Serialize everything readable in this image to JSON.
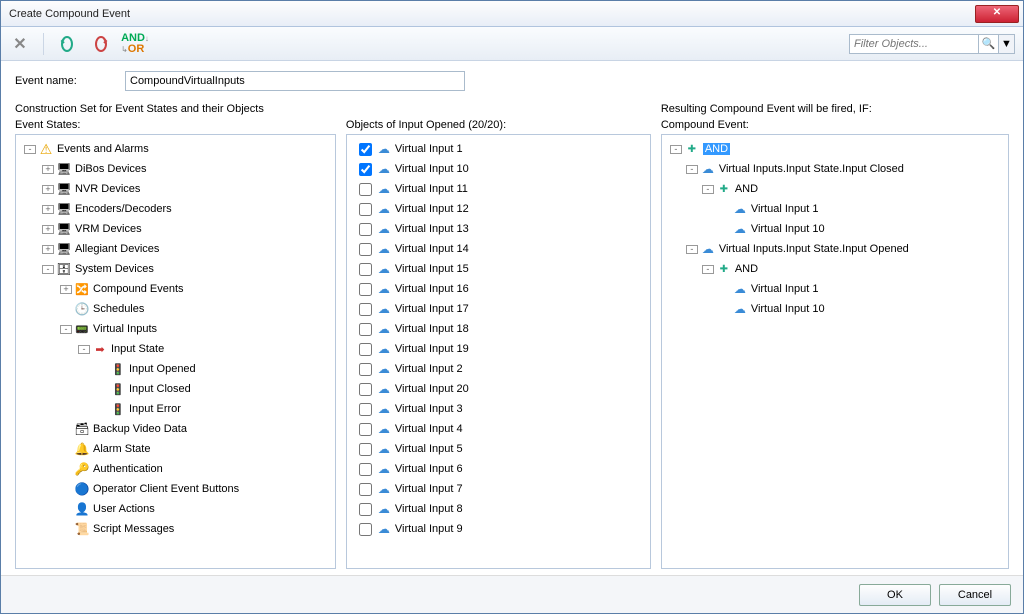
{
  "window": {
    "title": "Create Compound Event"
  },
  "toolbar": {
    "filter_placeholder": "Filter Objects...",
    "and_label": "AND",
    "or_label": "OR"
  },
  "form": {
    "event_name_label": "Event name:",
    "event_name_value": "CompoundVirtualInputs"
  },
  "labels": {
    "construction": "Construction Set for Event States and their Objects",
    "event_states": "Event States:",
    "objects": "Objects of Input Opened (20/20):",
    "resulting": "Resulting Compound Event will be fired, IF:",
    "compound": "Compound Event:"
  },
  "event_states_tree": [
    {
      "level": 0,
      "tw": "-",
      "icon": "i-warn",
      "label": "Events and Alarms"
    },
    {
      "level": 1,
      "tw": "+",
      "icon": "i-dev",
      "label": "DiBos Devices"
    },
    {
      "level": 1,
      "tw": "+",
      "icon": "i-dev",
      "label": "NVR Devices"
    },
    {
      "level": 1,
      "tw": "+",
      "icon": "i-dev",
      "label": "Encoders/Decoders"
    },
    {
      "level": 1,
      "tw": "+",
      "icon": "i-dev",
      "label": "VRM Devices"
    },
    {
      "level": 1,
      "tw": "+",
      "icon": "i-dev",
      "label": "Allegiant Devices"
    },
    {
      "level": 1,
      "tw": "-",
      "icon": "i-sys",
      "label": "System Devices"
    },
    {
      "level": 2,
      "tw": "+",
      "icon": "i-comp",
      "label": "Compound Events"
    },
    {
      "level": 2,
      "tw": " ",
      "icon": "i-clock",
      "label": "Schedules"
    },
    {
      "level": 2,
      "tw": "-",
      "icon": "i-vinp",
      "label": "Virtual Inputs"
    },
    {
      "level": 3,
      "tw": "-",
      "icon": "i-arrow",
      "label": "Input State"
    },
    {
      "level": 4,
      "tw": " ",
      "icon": "i-bulb",
      "label": "Input Opened"
    },
    {
      "level": 4,
      "tw": " ",
      "icon": "i-bulb",
      "label": "Input Closed"
    },
    {
      "level": 4,
      "tw": " ",
      "icon": "i-bulb",
      "label": "Input Error"
    },
    {
      "level": 2,
      "tw": " ",
      "icon": "i-db",
      "label": "Backup Video Data"
    },
    {
      "level": 2,
      "tw": " ",
      "icon": "i-alarm",
      "label": "Alarm State"
    },
    {
      "level": 2,
      "tw": " ",
      "icon": "i-key",
      "label": "Authentication"
    },
    {
      "level": 2,
      "tw": " ",
      "icon": "i-oper",
      "label": "Operator Client Event Buttons"
    },
    {
      "level": 2,
      "tw": " ",
      "icon": "i-user",
      "label": "User Actions"
    },
    {
      "level": 2,
      "tw": " ",
      "icon": "i-script",
      "label": "Script Messages"
    }
  ],
  "objects_list": [
    {
      "checked": true,
      "label": "Virtual Input 1"
    },
    {
      "checked": true,
      "label": "Virtual Input 10"
    },
    {
      "checked": false,
      "label": "Virtual Input 11"
    },
    {
      "checked": false,
      "label": "Virtual Input 12"
    },
    {
      "checked": false,
      "label": "Virtual Input 13"
    },
    {
      "checked": false,
      "label": "Virtual Input 14"
    },
    {
      "checked": false,
      "label": "Virtual Input 15"
    },
    {
      "checked": false,
      "label": "Virtual Input 16"
    },
    {
      "checked": false,
      "label": "Virtual Input 17"
    },
    {
      "checked": false,
      "label": "Virtual Input 18"
    },
    {
      "checked": false,
      "label": "Virtual Input 19"
    },
    {
      "checked": false,
      "label": "Virtual Input 2"
    },
    {
      "checked": false,
      "label": "Virtual Input 20"
    },
    {
      "checked": false,
      "label": "Virtual Input 3"
    },
    {
      "checked": false,
      "label": "Virtual Input 4"
    },
    {
      "checked": false,
      "label": "Virtual Input 5"
    },
    {
      "checked": false,
      "label": "Virtual Input 6"
    },
    {
      "checked": false,
      "label": "Virtual Input 7"
    },
    {
      "checked": false,
      "label": "Virtual Input 8"
    },
    {
      "checked": false,
      "label": "Virtual Input 9"
    }
  ],
  "compound_tree": [
    {
      "level": 0,
      "tw": "-",
      "icon": "i-and",
      "label": "AND",
      "selected": true
    },
    {
      "level": 1,
      "tw": "-",
      "icon": "i-cloud",
      "label": "Virtual Inputs.Input State.Input Closed"
    },
    {
      "level": 2,
      "tw": "-",
      "icon": "i-and",
      "label": "AND"
    },
    {
      "level": 3,
      "tw": " ",
      "icon": "i-cloud",
      "label": "Virtual Input 1"
    },
    {
      "level": 3,
      "tw": " ",
      "icon": "i-cloud",
      "label": "Virtual Input 10"
    },
    {
      "level": 1,
      "tw": "-",
      "icon": "i-cloud",
      "label": "Virtual Inputs.Input State.Input Opened"
    },
    {
      "level": 2,
      "tw": "-",
      "icon": "i-and",
      "label": "AND"
    },
    {
      "level": 3,
      "tw": " ",
      "icon": "i-cloud",
      "label": "Virtual Input 1"
    },
    {
      "level": 3,
      "tw": " ",
      "icon": "i-cloud",
      "label": "Virtual Input 10"
    }
  ],
  "buttons": {
    "ok": "OK",
    "cancel": "Cancel"
  }
}
